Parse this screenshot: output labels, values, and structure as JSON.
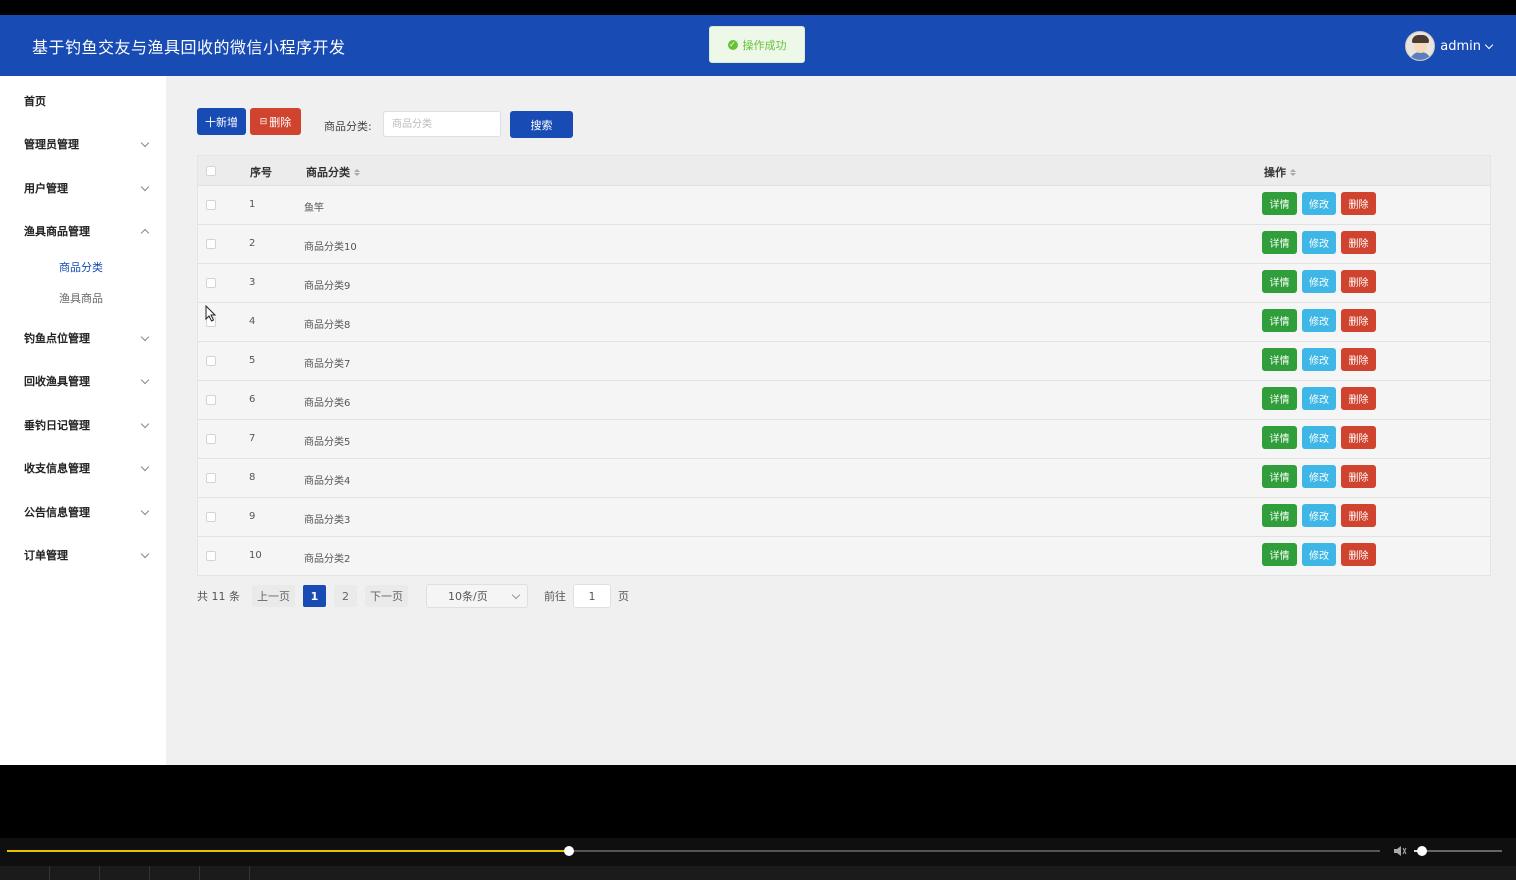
{
  "header": {
    "title": "基于钓鱼交友与渔具回收的微信小程序开发",
    "toast": "操作成功",
    "username": "admin"
  },
  "sidebar": {
    "items": [
      {
        "label": "首页",
        "chevron": "none"
      },
      {
        "label": "管理员管理",
        "chevron": "down"
      },
      {
        "label": "用户管理",
        "chevron": "down"
      },
      {
        "label": "渔具商品管理",
        "chevron": "up",
        "children": [
          {
            "label": "商品分类",
            "active": true
          },
          {
            "label": "渔具商品",
            "active": false
          }
        ]
      },
      {
        "label": "钓鱼点位管理",
        "chevron": "down"
      },
      {
        "label": "回收渔具管理",
        "chevron": "down"
      },
      {
        "label": "垂钓日记管理",
        "chevron": "down"
      },
      {
        "label": "收支信息管理",
        "chevron": "down"
      },
      {
        "label": "公告信息管理",
        "chevron": "down"
      },
      {
        "label": "订单管理",
        "chevron": "down"
      }
    ]
  },
  "toolbar": {
    "add_label": "十新增",
    "delete_label": "删除",
    "search_label": "商品分类:",
    "search_placeholder": "商品分类",
    "search_button": "搜索"
  },
  "table": {
    "columns": {
      "index": "序号",
      "category": "商品分类",
      "actions": "操作"
    },
    "rows": [
      {
        "index": "1",
        "category": "鱼竿"
      },
      {
        "index": "2",
        "category": "商品分类10"
      },
      {
        "index": "3",
        "category": "商品分类9"
      },
      {
        "index": "4",
        "category": "商品分类8"
      },
      {
        "index": "5",
        "category": "商品分类7"
      },
      {
        "index": "6",
        "category": "商品分类6"
      },
      {
        "index": "7",
        "category": "商品分类5"
      },
      {
        "index": "8",
        "category": "商品分类4"
      },
      {
        "index": "9",
        "category": "商品分类3"
      },
      {
        "index": "10",
        "category": "商品分类2"
      }
    ],
    "actions": {
      "detail": "详情",
      "edit": "修改",
      "delete": "删除"
    }
  },
  "pagination": {
    "total": "共 11 条",
    "prev": "上一页",
    "pages": [
      "1",
      "2"
    ],
    "current_page": "1",
    "next": "下一页",
    "page_size": "10条/页",
    "goto_label": "前往",
    "goto_value": "1",
    "goto_suffix": "页"
  },
  "player": {
    "progress": 0.409,
    "volume": 0.09
  },
  "colors": {
    "header_bg": "#184bb3",
    "primary": "#184bb3",
    "danger": "#d0442f",
    "success": "#2f9e3b",
    "info": "#3fb7e6"
  }
}
